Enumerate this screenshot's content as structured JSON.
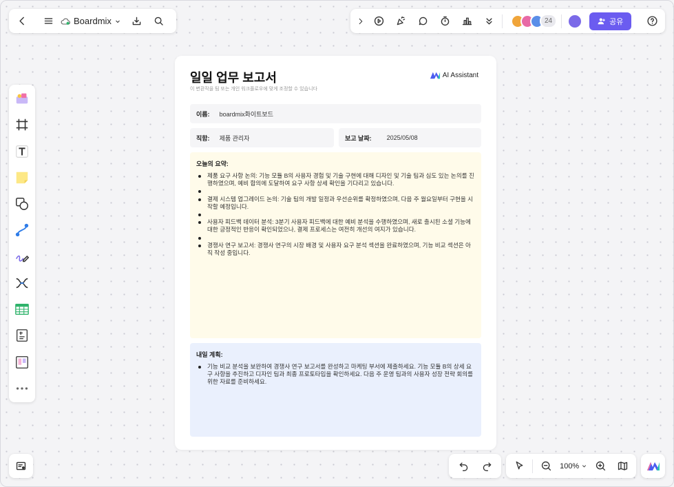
{
  "topbar": {
    "brand": "Boardmix",
    "avatars": [
      "#f0a53a",
      "#e86aa6",
      "#5a8ee8"
    ],
    "avatar_count": "24",
    "share_label": "공유"
  },
  "doc": {
    "title": "일일 업무 보고서",
    "subtitle": "이 변환작을 팀 또는 개인 워크플로우에 맞게 조정할 수 있습니다",
    "ai_label": "AI Assistant",
    "name_label": "이름:",
    "name_value": "boardmix화이트보드",
    "role_label": "직함:",
    "role_value": "제품 관리자",
    "date_label": "보고 날짜:",
    "date_value": "2025/05/08",
    "summary_title": "오늘의 요약:",
    "summary_items": [
      "제품 요구 사항 논의:  기능 모듈 B의 사용자 경험 및 기술 구현에 대해 디자인 및 기술 팀과 심도 있는 논의를 진행하였으며, 예비 합의에 도달하여 요구 사항 상세 확인을 기다리고 있습니다.",
      "",
      "결제 시스템 업그레이드 논의:  기술 팀의 개발 일정과 우선순위를 확정하였으며, 다음 주 월요일부터 구현을 시작할 예정입니다.",
      "",
      "사용자 피드백 데이터 분석:  3분기 사용자 피드백에 대한 예비 분석을 수행하였으며, 새로 출시된 소셜 기능에 대한 긍정적인 반응이 확인되었으나, 결제 프로세스는 여전히 개선의 여지가 있습니다.",
      "",
      "경쟁사 연구 보고서:  경쟁사 연구의 시장 배경 및 사용자 요구 분석 섹션을 완료하였으며, 기능 비교 섹션은 아직 작성 중입니다."
    ],
    "plan_title": "내일 계획:",
    "plan_items": [
      "기능 비교 분석을 보완하여 경쟁사 연구 보고서를 완성하고 마케팅 부서에 제출하세요. 기능 모듈 B의 상세 요구 사항을 추진하고 디자인 팀과 최종 프로토타입을 확인하세요. 다음 주 운영 팀과의 사용자 성장 전략 회의를 위한 자료를 준비하세요."
    ]
  },
  "bottom": {
    "zoom": "100%"
  }
}
